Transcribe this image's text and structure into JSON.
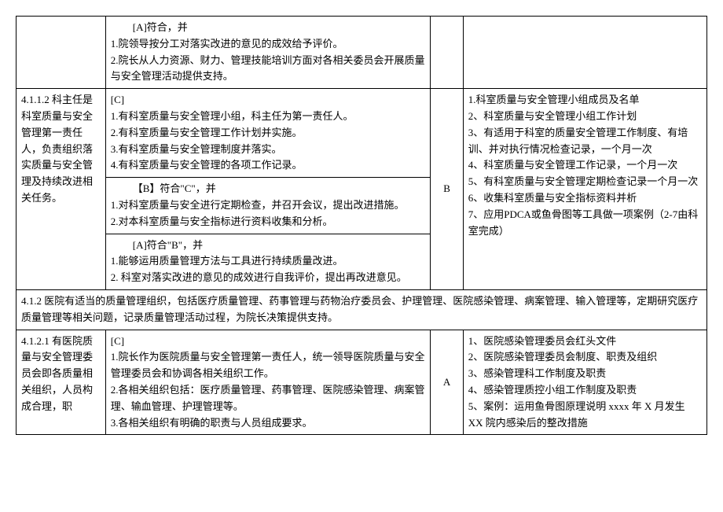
{
  "row1": {
    "c2_header": "[A]符合，并",
    "c2_line1": "1.院领导按分工对落实改进的意见的成效给予评价。",
    "c2_line2": "2.院长从人力资源、财力、管理技能培训方面对各相关委员会开展质量与安全管理活动提供支持。"
  },
  "row2": {
    "c1": "4.1.1.2 科主任是科室质量与安全管理第一责任人，负责组织落实质量与安全管理及持续改进相关任务。",
    "c2a_header": "[C]",
    "c2a_line1": "1.有科室质量与安全管理小组，科主任为第一责任人。",
    "c2a_line2": "2.有科室质量与安全管理工作计划并实施。",
    "c2a_line3": "3.有科室质量与安全管理制度并落实。",
    "c2a_line4": "4.有科室质量与安全管理的各项工作记录。",
    "c2b_header": "【B】符合\"C\"，并",
    "c2b_line1": "1.对科室质量与安全进行定期检查，并召开会议，提出改进措施。",
    "c2b_line2": "2.对本科室质量与安全指标进行资料收集和分析。",
    "c2c_header": "[A]符合\"B\"，并",
    "c2c_line1": "1.能够运用质量管理方法与工具进行持续质量改进。",
    "c2c_line2": "2. 科室对落实改进的意见的成效进行自我评价，提出再改进意见。",
    "c3": "B",
    "c4_line1": "1.科室质量与安全管理小组成员及名单",
    "c4_line2": "2、科室质量与安全管理小组工作计划",
    "c4_line3": "3、有适用于科室的质量安全管理工作制度、有培训、并对执行情况检查记录，一个月一次",
    "c4_line4": "4、科室质量与安全管理工作记录，一个月一次",
    "c4_line5": "5、有科室质量与安全管理定期检查记录一个月一次",
    "c4_line6": "6、收集科室质量与安全指标资料并析",
    "c4_line7": "7、应用PDCA或鱼骨图等工具做一项案例（2-7由科室完成）"
  },
  "section": {
    "text": "4.1.2 医院有适当的质量管理组织，包括医疗质量管理、药事管理与药物治疗委员会、护理管理、医院感染管理、病案管理、输入管理等，定期研究医疗质量管理等相关问题，记录质量管理活动过程，为院长决策提供支持。"
  },
  "row3": {
    "c1": "4.1.2.1 有医院质量与安全管理委员会即各质量相关组织，人员构成合理，职",
    "c2_header": "[C]",
    "c2_line1": "1.院长作为医院质量与安全管理第一责任人，统一领导医院质量与安全管理委员会和协调各相关组织工作。",
    "c2_line2": "2.各相关组织包括：医疗质量管理、药事管理、医院感染管理、病案管理、输血管理、护理管理等。",
    "c2_line3": "3.各相关组织有明确的职责与人员组成要求。",
    "c3": "A",
    "c4_line1": "1、医院感染管理委员会红头文件",
    "c4_line2": "2、医院感染管理委员会制度、职责及组织",
    "c4_line3": "3、感染管理科工作制度及职责",
    "c4_line4": "4、感染管理质控小组工作制度及职责",
    "c4_line5": "5、案例：运用鱼骨图原理说明 xxxx 年 X 月发生 XX 院内感染后的整改措施"
  }
}
